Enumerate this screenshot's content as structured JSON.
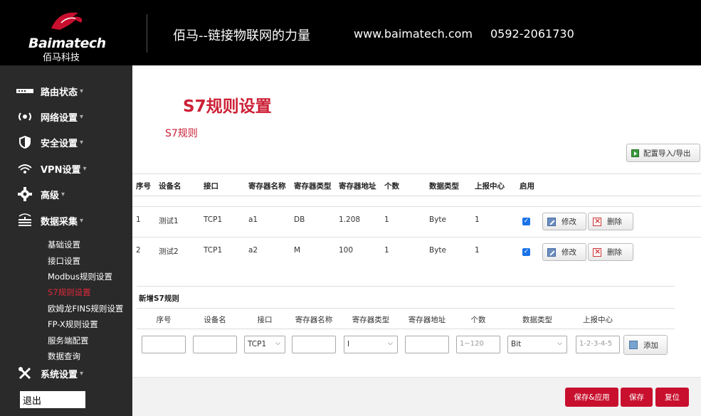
{
  "header": {
    "logo_en": "Baimatech",
    "logo_cn": "佰马科技",
    "slogan": "佰马--链接物联网的力量",
    "website": "www.baimatech.com",
    "phone": "0592-2061730"
  },
  "sidebar": {
    "items": [
      {
        "label": "路由状态",
        "icon": "router-status-icon",
        "caret": "▾"
      },
      {
        "label": "网络设置",
        "icon": "signal-icon",
        "caret": "▾"
      },
      {
        "label": "安全设置",
        "icon": "shield-icon",
        "caret": "▾"
      },
      {
        "label": "VPN设置",
        "icon": "wifi-icon",
        "caret": "▾"
      },
      {
        "label": "高级",
        "icon": "gear-icon",
        "caret": "▾"
      },
      {
        "label": "数据采集",
        "icon": "data-collect-icon",
        "caret": "▾"
      },
      {
        "label": "系统设置",
        "icon": "tools-icon",
        "caret": "▾"
      }
    ],
    "sub_items": [
      "基础设置",
      "接口设置",
      "Modbus规则设置",
      "S7规则设置",
      "欧姆龙FINS规则设置",
      "FP-X规则设置",
      "服务端配置",
      "数据查询"
    ],
    "logout": "退出"
  },
  "main": {
    "title": "S7规则设置",
    "section_title": "S7规则",
    "import_export": "配置导入/导出",
    "table": {
      "headers": [
        "序号",
        "设备名",
        "接口",
        "寄存器名称",
        "寄存器类型",
        "寄存器地址",
        "个数",
        "数据类型",
        "上报中心",
        "启用"
      ],
      "rows": [
        {
          "no": "1",
          "device": "测试1",
          "iface": "TCP1",
          "reg_name": "a1",
          "reg_type": "DB",
          "reg_addr": "1.208",
          "count": "1",
          "dtype": "Byte",
          "center": "1",
          "enabled": true
        },
        {
          "no": "2",
          "device": "测试2",
          "iface": "TCP1",
          "reg_name": "a2",
          "reg_type": "M",
          "reg_addr": "100",
          "count": "1",
          "dtype": "Byte",
          "center": "1",
          "enabled": true
        }
      ],
      "edit_label": "修改",
      "delete_label": "删除"
    },
    "add": {
      "title": "新增S7规则",
      "headers": [
        "序号",
        "设备名",
        "接口",
        "寄存器名称",
        "寄存器类型",
        "寄存器地址",
        "个数",
        "数据类型",
        "上报中心"
      ],
      "iface_value": "TCP1",
      "reg_type_value": "I",
      "count_placeholder": "1~120",
      "dtype_value": "Bit",
      "center_placeholder": "1-2-3-4-5",
      "add_label": "添加"
    },
    "footer": {
      "save_apply": "保存&应用",
      "save": "保存",
      "reset": "复位"
    }
  }
}
